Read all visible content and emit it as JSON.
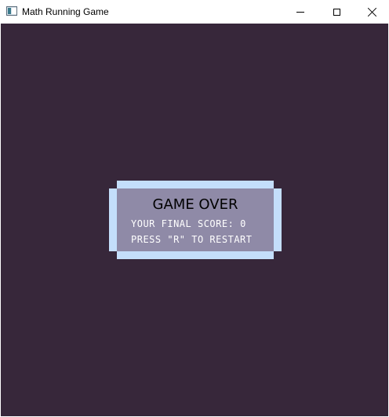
{
  "window": {
    "title": "Math Running Game",
    "icon": "app-window-icon",
    "controls": {
      "minimize_icon": "minimize-icon",
      "maximize_icon": "maximize-icon",
      "close_icon": "close-icon"
    }
  },
  "game": {
    "background_color": "#37273a",
    "panel": {
      "border_color": "#c4defb",
      "fill_color": "#8f8aa7",
      "title": "GAME OVER",
      "score_label": "YOUR FINAL SCORE:",
      "score_value": "0",
      "restart_hint": "PRESS \"R\" TO RESTART"
    }
  }
}
